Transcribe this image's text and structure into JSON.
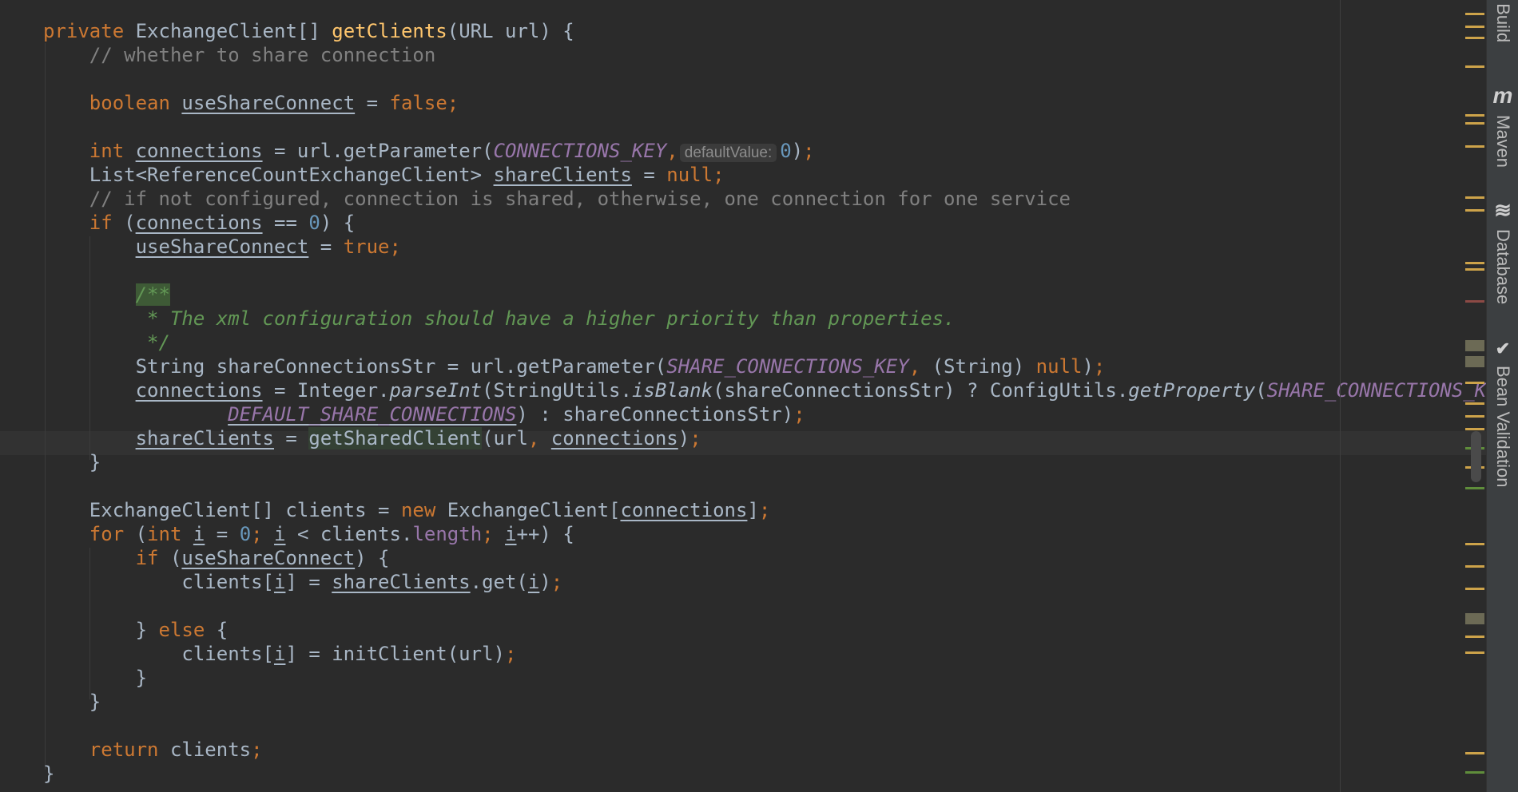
{
  "editor": {
    "lines": [
      [
        {
          "t": "private",
          "c": "kw"
        },
        {
          "t": " ExchangeClient[] "
        },
        {
          "t": "getClients",
          "c": "fn"
        },
        {
          "t": "(URL url) {"
        }
      ],
      [
        {
          "t": "    // whether to share connection",
          "c": "cmt"
        }
      ],
      [],
      [
        {
          "t": "    "
        },
        {
          "t": "boolean",
          "c": "kw"
        },
        {
          "t": " "
        },
        {
          "t": "useShareConnect",
          "c": "u"
        },
        {
          "t": " = "
        },
        {
          "t": "false",
          "c": "kw"
        },
        {
          "t": ";",
          "c": "kw"
        }
      ],
      [],
      [
        {
          "t": "    "
        },
        {
          "t": "int",
          "c": "kw"
        },
        {
          "t": " "
        },
        {
          "t": "connections",
          "c": "u"
        },
        {
          "t": " = url.getParameter("
        },
        {
          "t": "CONNECTIONS_KEY",
          "c": "const"
        },
        {
          "t": ",",
          "c": "kw"
        },
        {
          "t": "defaultValue:",
          "c": "hint"
        },
        {
          "t": "0",
          "c": "num"
        },
        {
          "t": ")"
        },
        {
          "t": ";",
          "c": "kw"
        }
      ],
      [
        {
          "t": "    List<ReferenceCountExchangeClient> "
        },
        {
          "t": "shareClients",
          "c": "u"
        },
        {
          "t": " = "
        },
        {
          "t": "null",
          "c": "kw"
        },
        {
          "t": ";",
          "c": "kw"
        }
      ],
      [
        {
          "t": "    // if not configured, connection is shared, otherwise, one connection for one service",
          "c": "cmt"
        }
      ],
      [
        {
          "t": "    "
        },
        {
          "t": "if",
          "c": "kw"
        },
        {
          "t": " ("
        },
        {
          "t": "connections",
          "c": "u"
        },
        {
          "t": " == "
        },
        {
          "t": "0",
          "c": "num"
        },
        {
          "t": ") {"
        }
      ],
      [
        {
          "t": "        "
        },
        {
          "t": "useShareConnect",
          "c": "u"
        },
        {
          "t": " = "
        },
        {
          "t": "true",
          "c": "kw"
        },
        {
          "t": ";",
          "c": "kw"
        }
      ],
      [],
      [
        {
          "t": "        "
        },
        {
          "t": "/**",
          "c": "doc docmark"
        }
      ],
      [
        {
          "t": "         * The xml configuration should have a higher priority than properties.",
          "c": "doc"
        }
      ],
      [
        {
          "t": "         */",
          "c": "doc"
        }
      ],
      [
        {
          "t": "        String shareConnectionsStr = url.getParameter("
        },
        {
          "t": "SHARE_CONNECTIONS_KEY",
          "c": "const"
        },
        {
          "t": ",",
          "c": "kw"
        },
        {
          "t": " (String) "
        },
        {
          "t": "null",
          "c": "kw"
        },
        {
          "t": ")"
        },
        {
          "t": ";",
          "c": "kw"
        }
      ],
      [
        {
          "t": "        "
        },
        {
          "t": "connections",
          "c": "u"
        },
        {
          "t": " = Integer."
        },
        {
          "t": "parseInt",
          "c": "static"
        },
        {
          "t": "(StringUtils."
        },
        {
          "t": "isBlank",
          "c": "static"
        },
        {
          "t": "(shareConnectionsStr) ? ConfigUtils."
        },
        {
          "t": "getProperty",
          "c": "static"
        },
        {
          "t": "("
        },
        {
          "t": "SHARE_CONNECTIONS_KEY",
          "c": "const"
        },
        {
          "t": ",",
          "c": "kw"
        }
      ],
      [
        {
          "t": "                "
        },
        {
          "t": "DEFAULT_SHARE_CONNECTIONS",
          "c": "const u"
        },
        {
          "t": ") : shareConnectionsStr)"
        },
        {
          "t": ";",
          "c": "kw"
        }
      ],
      [
        {
          "t": "        "
        },
        {
          "t": "shareClients",
          "c": "u"
        },
        {
          "t": " = "
        },
        {
          "t": "getSharedClient",
          "c": "hl"
        },
        {
          "t": "(url"
        },
        {
          "t": ",",
          "c": "kw"
        },
        {
          "t": " "
        },
        {
          "t": "connections",
          "c": "u"
        },
        {
          "t": ")"
        },
        {
          "t": ";",
          "c": "kw"
        }
      ],
      [
        {
          "t": "    }"
        }
      ],
      [],
      [
        {
          "t": "    ExchangeClient[] clients = "
        },
        {
          "t": "new",
          "c": "kw"
        },
        {
          "t": " ExchangeClient["
        },
        {
          "t": "connections",
          "c": "u"
        },
        {
          "t": "]"
        },
        {
          "t": ";",
          "c": "kw"
        }
      ],
      [
        {
          "t": "    "
        },
        {
          "t": "for",
          "c": "kw"
        },
        {
          "t": " ("
        },
        {
          "t": "int",
          "c": "kw"
        },
        {
          "t": " "
        },
        {
          "t": "i",
          "c": "u"
        },
        {
          "t": " = "
        },
        {
          "t": "0",
          "c": "num"
        },
        {
          "t": ";",
          "c": "kw"
        },
        {
          "t": " "
        },
        {
          "t": "i",
          "c": "u"
        },
        {
          "t": " < clients."
        },
        {
          "t": "length",
          "c": "field"
        },
        {
          "t": ";",
          "c": "kw"
        },
        {
          "t": " "
        },
        {
          "t": "i",
          "c": "u"
        },
        {
          "t": "++) {"
        }
      ],
      [
        {
          "t": "        "
        },
        {
          "t": "if",
          "c": "kw"
        },
        {
          "t": " ("
        },
        {
          "t": "useShareConnect",
          "c": "u"
        },
        {
          "t": ") {"
        }
      ],
      [
        {
          "t": "            clients["
        },
        {
          "t": "i",
          "c": "u"
        },
        {
          "t": "] = "
        },
        {
          "t": "shareClients",
          "c": "u"
        },
        {
          "t": ".get("
        },
        {
          "t": "i",
          "c": "u"
        },
        {
          "t": ")"
        },
        {
          "t": ";",
          "c": "kw"
        }
      ],
      [],
      [
        {
          "t": "        } "
        },
        {
          "t": "else",
          "c": "kw"
        },
        {
          "t": " {"
        }
      ],
      [
        {
          "t": "            clients["
        },
        {
          "t": "i",
          "c": "u"
        },
        {
          "t": "] = initClient(url)"
        },
        {
          "t": ";",
          "c": "kw"
        }
      ],
      [
        {
          "t": "        }"
        }
      ],
      [
        {
          "t": "    }"
        }
      ],
      [],
      [
        {
          "t": "    "
        },
        {
          "t": "return",
          "c": "kw"
        },
        {
          "t": " clients"
        },
        {
          "t": ";",
          "c": "kw"
        }
      ],
      [
        {
          "t": "}"
        }
      ]
    ]
  },
  "tool_window_tabs": [
    {
      "label": "t Build",
      "icon": "build-icon"
    },
    {
      "label": "Maven",
      "icon": "maven-icon",
      "glyph": "m"
    },
    {
      "label": "Database",
      "icon": "database-icon",
      "glyph": "≋"
    },
    {
      "label": "Bean Validation",
      "icon": "bean-validation-icon",
      "glyph": "✔"
    }
  ],
  "colors": {
    "background": "#2b2b2b",
    "keyword": "#cc7832",
    "text": "#a9b7c6",
    "comment": "#808080",
    "doc_comment": "#629755",
    "function": "#ffc66d",
    "constant": "#9876aa",
    "number": "#6897bb",
    "marker_warning": "#cda34a"
  }
}
